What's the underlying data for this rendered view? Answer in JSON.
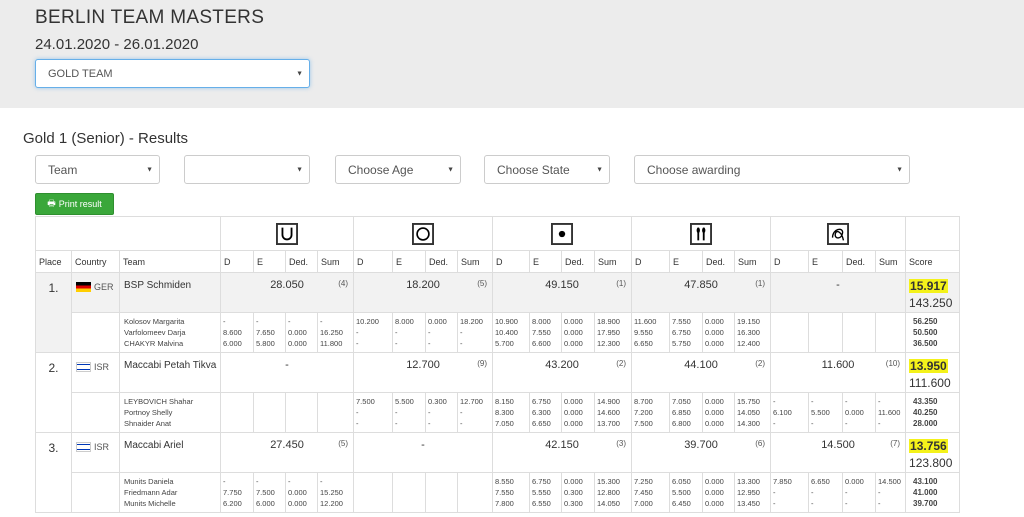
{
  "header": {
    "title": "BERLIN TEAM MASTERS",
    "dates": "24.01.2020 - 26.01.2020",
    "team_select": "GOLD TEAM"
  },
  "results_title": "Gold 1 (Senior) - Results",
  "filters": {
    "team": "Team",
    "blank": "",
    "age": "Choose Age",
    "state": "Choose State",
    "awarding": "Choose awarding"
  },
  "print_label": "Print result",
  "columns": {
    "place": "Place",
    "country": "Country",
    "team": "Team",
    "d": "D",
    "e": "E",
    "ded": "Ded.",
    "sum": "Sum",
    "score": "Score"
  },
  "apparatus": [
    {
      "icon": "hoop-icon"
    },
    {
      "icon": "ball-icon"
    },
    {
      "icon": "clubs-icon"
    },
    {
      "icon": "ribbon-icon"
    },
    {
      "icon": "rope-icon"
    }
  ],
  "rows": [
    {
      "place": "1.",
      "country": "GER",
      "team": "BSP Schmiden",
      "app_sums": [
        {
          "s": "28.050",
          "r": "(4)"
        },
        {
          "s": "18.200",
          "r": "(5)"
        },
        {
          "s": "49.150",
          "r": "(1)"
        },
        {
          "s": "47.850",
          "r": "(1)"
        },
        {
          "s": "-",
          "r": ""
        }
      ],
      "score_hl": "15.917",
      "score_total": "143.250",
      "gymnasts": "Kolosov Margarita\nVarfolomeev Darja\nCHAKYR Malvina",
      "apps": [
        [
          "-\n8.600\n6.000",
          "-\n7.650\n5.800",
          "-\n0.000\n0.000",
          "-\n16.250\n11.800"
        ],
        [
          "10.200\n-\n-",
          "8.000\n-\n-",
          "0.000\n-\n-",
          "18.200\n-\n-"
        ],
        [
          "10.900\n10.400\n5.700",
          "8.000\n7.550\n6.600",
          "0.000\n0.000\n0.000",
          "18.900\n17.950\n12.300"
        ],
        [
          "11.600\n9.550\n6.650",
          "7.550\n6.750\n5.750",
          "0.000\n0.000\n0.000",
          "19.150\n16.300\n12.400"
        ],
        [
          "",
          "",
          "",
          ""
        ]
      ],
      "gym_scores": "56.250\n50.500\n36.500"
    },
    {
      "place": "2.",
      "country": "ISR",
      "team": "Maccabi Petah Tikva",
      "app_sums": [
        {
          "s": "-",
          "r": ""
        },
        {
          "s": "12.700",
          "r": "(9)"
        },
        {
          "s": "43.200",
          "r": "(2)"
        },
        {
          "s": "44.100",
          "r": "(2)"
        },
        {
          "s": "11.600",
          "r": "(10)"
        }
      ],
      "score_hl": "13.950",
      "score_total": "111.600",
      "gymnasts": "LEYBOVICH Shahar\nPortnoy Shelly\nShnaider Anat",
      "apps": [
        [
          "",
          "",
          "",
          ""
        ],
        [
          "7.500\n-\n-",
          "5.500\n-\n-",
          "0.300\n-\n-",
          "12.700\n-\n-"
        ],
        [
          "8.150\n8.300\n7.050",
          "6.750\n6.300\n6.650",
          "0.000\n0.000\n0.000",
          "14.900\n14.600\n13.700"
        ],
        [
          "8.700\n7.200\n7.500",
          "7.050\n6.850\n6.800",
          "0.000\n0.000\n0.000",
          "15.750\n14.050\n14.300"
        ],
        [
          "-\n6.100\n-",
          "-\n5.500\n-",
          "-\n0.000\n-",
          "-\n11.600\n-"
        ]
      ],
      "gym_scores": "43.350\n40.250\n28.000"
    },
    {
      "place": "3.",
      "country": "ISR",
      "team": "Maccabi Ariel",
      "app_sums": [
        {
          "s": "27.450",
          "r": "(5)"
        },
        {
          "s": "-",
          "r": ""
        },
        {
          "s": "42.150",
          "r": "(3)"
        },
        {
          "s": "39.700",
          "r": "(6)"
        },
        {
          "s": "14.500",
          "r": "(7)"
        }
      ],
      "score_hl": "13.756",
      "score_total": "123.800",
      "gymnasts": "Munits Daniela\nFriedmann Adar\nMunits Michelle",
      "apps": [
        [
          "-\n7.750\n6.200",
          "-\n7.500\n6.000",
          "-\n0.000\n0.000",
          "-\n15.250\n12.200"
        ],
        [
          "",
          "",
          "",
          ""
        ],
        [
          "8.550\n7.550\n7.800",
          "6.750\n5.550\n6.550",
          "0.000\n0.300\n0.300",
          "15.300\n12.800\n14.050"
        ],
        [
          "7.250\n7.450\n7.000",
          "6.050\n5.500\n6.450",
          "0.000\n0.000\n0.000",
          "13.300\n12.950\n13.450"
        ],
        [
          "7.850\n-\n-",
          "6.650\n-\n-",
          "0.000\n-\n-",
          "14.500\n-\n-"
        ]
      ],
      "gym_scores": "43.100\n41.000\n39.700"
    }
  ]
}
